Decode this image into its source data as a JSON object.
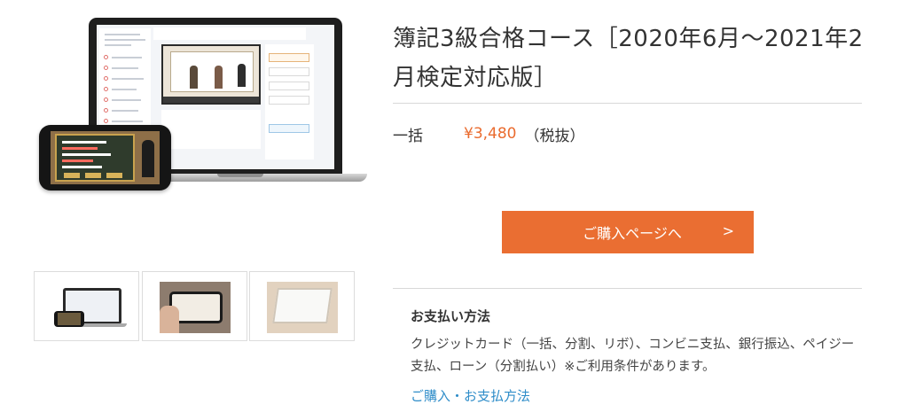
{
  "product": {
    "title": "簿記3級合格コース［2020年6月〜2021年2月検定対応版］",
    "price_label": "一括",
    "price_amount": "¥3,480",
    "price_note": "（税抜）"
  },
  "buy_button": {
    "label": "ご購入ページへ",
    "chevron": ">"
  },
  "payment": {
    "heading": "お支払い方法",
    "description": "クレジットカード（一括、分割、リボ）、コンビニ支払、銀行振込、ペイジー支払、ローン（分割払い）※ご利用条件があります。",
    "link_text": "ご購入・お支払方法"
  },
  "colors": {
    "accent_orange": "#ea6e32",
    "price_orange": "#ea6b2e",
    "link_blue": "#2f8dc9"
  }
}
